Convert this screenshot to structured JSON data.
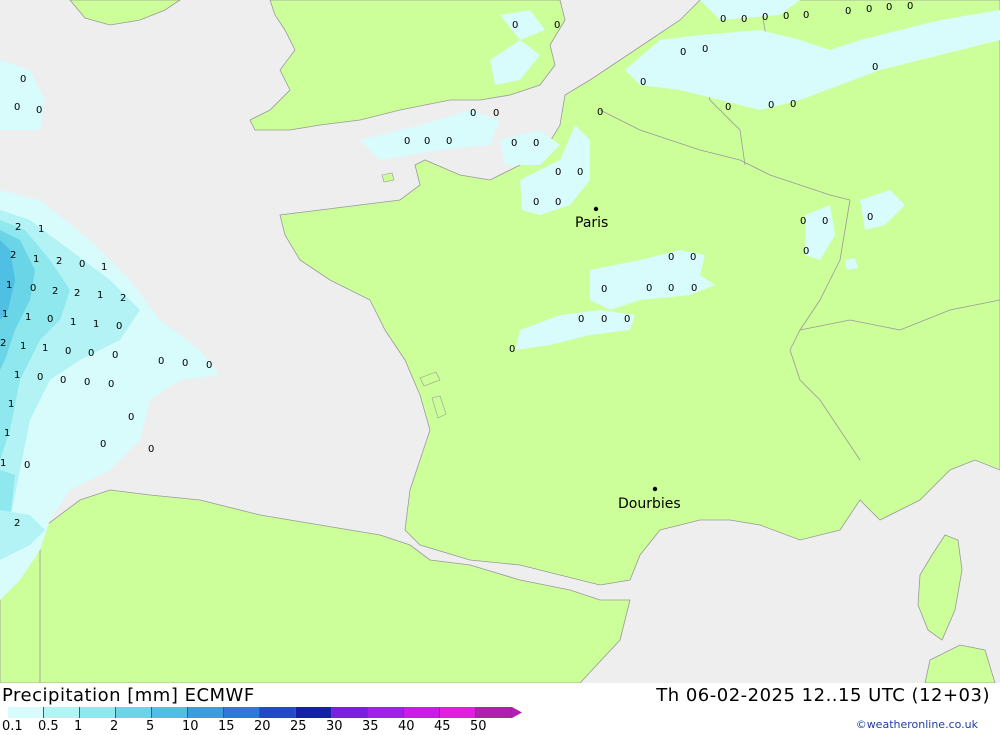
{
  "header": {
    "product_title": "Precipitation [mm] ECMWF",
    "valid_time": "Th 06-02-2025 12..15 UTC (12+03)",
    "credit": "©weatheronline.co.uk"
  },
  "colors": {
    "land": "#ccff99",
    "sea": "#eeeeee",
    "border": "#999999"
  },
  "legend": {
    "labels": [
      "0.1",
      "0.5",
      "1",
      "2",
      "5",
      "10",
      "15",
      "20",
      "25",
      "30",
      "35",
      "40",
      "45",
      "50"
    ],
    "colors": [
      "#d8fbfc",
      "#b4f3f5",
      "#8ee8ee",
      "#69d5e6",
      "#4fbfe3",
      "#3a9de0",
      "#2f77dd",
      "#2348c8",
      "#1520a8",
      "#7a1fe0",
      "#a21fe8",
      "#cc1be8",
      "#e21ee0",
      "#b020b0"
    ]
  },
  "cities": [
    {
      "name": "Paris"
    },
    {
      "name": "Dourbies"
    }
  ],
  "precip_values": [
    "0",
    "0",
    "0",
    "0",
    "0",
    "0",
    "0",
    "0",
    "0",
    "0",
    "0",
    "0",
    "0",
    "0",
    "0",
    "0",
    "0",
    "0",
    "0",
    "0",
    "2",
    "1",
    "2",
    "1",
    "2",
    "0",
    "1",
    "1",
    "0",
    "2",
    "2",
    "1",
    "2",
    "1",
    "1",
    "0",
    "1",
    "1",
    "0",
    "2",
    "1",
    "1",
    "0",
    "0",
    "0",
    "1",
    "0",
    "0",
    "0",
    "0",
    "0",
    "1",
    "0",
    "1",
    "0",
    "2",
    "1",
    "0",
    "0",
    "0",
    "0",
    "0",
    "0",
    "0",
    "0",
    "0",
    "0",
    "0",
    "0",
    "0",
    "0",
    "0",
    "0",
    "0",
    "0",
    "0",
    "0",
    "0",
    "0",
    "0",
    "0",
    "0",
    "0",
    "0",
    "0",
    "0",
    "0",
    "0"
  ]
}
